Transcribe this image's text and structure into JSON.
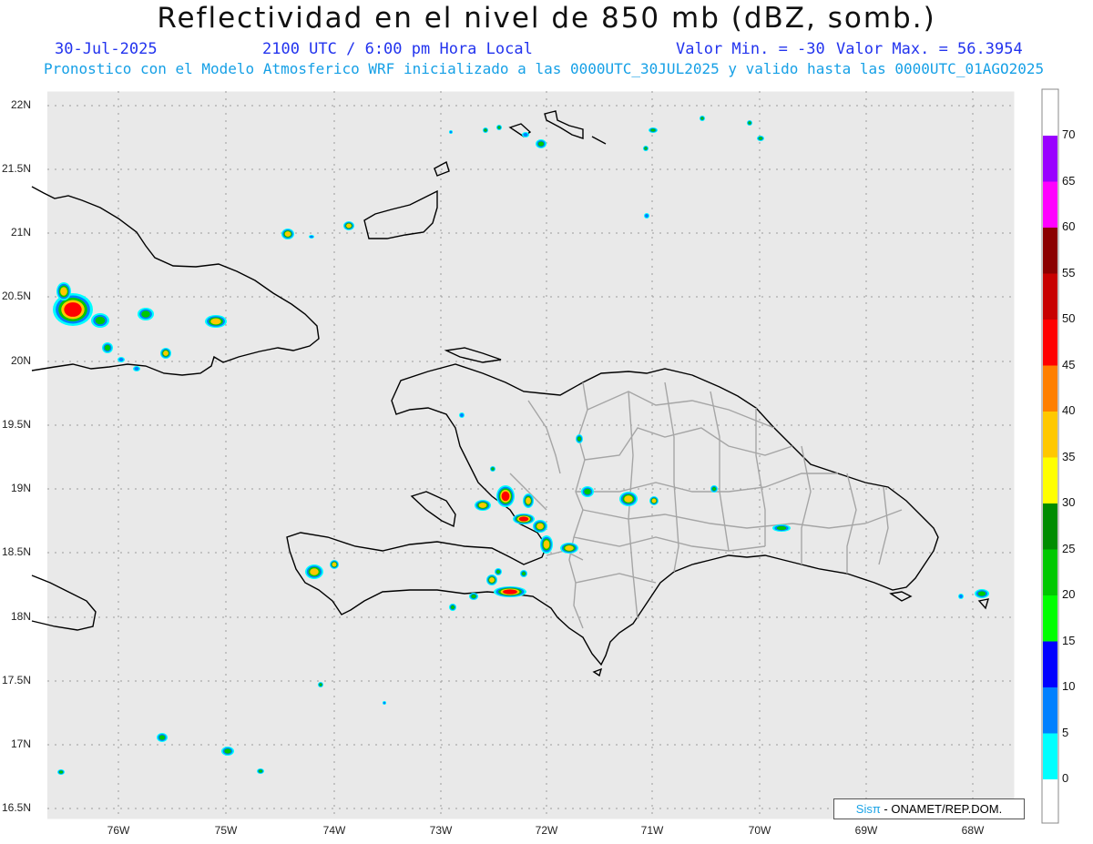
{
  "header": {
    "title": "Reflectividad en el nivel de 850 mb (dBZ, somb.)",
    "date": "30-Jul-2025",
    "time": "2100 UTC / 6:00 pm Hora Local",
    "min_label": "Valor Min. = -30",
    "max_label": "Valor Max. = 56.3954",
    "forecast_line": "Pronostico con el Modelo Atmosferico WRF inicializado a las 0000UTC_30JUL2025 y valido hasta las  0000UTC_01AGO2025"
  },
  "axes": {
    "lat_labels": [
      "22N",
      "21.5N",
      "21N",
      "20.5N",
      "20N",
      "19.5N",
      "19N",
      "18.5N",
      "18N",
      "17.5N",
      "17N",
      "16.5N"
    ],
    "lon_labels": [
      "76W",
      "75W",
      "74W",
      "73W",
      "72W",
      "71W",
      "70W",
      "69W",
      "68W"
    ]
  },
  "colorbar": {
    "ticks": [
      "70",
      "65",
      "60",
      "55",
      "50",
      "45",
      "40",
      "35",
      "30",
      "25",
      "20",
      "15",
      "10",
      "5",
      "0"
    ],
    "colors": [
      "#9a00ff",
      "#ff00ff",
      "#8b0000",
      "#c80000",
      "#ff0000",
      "#ff7f00",
      "#ffc800",
      "#ffff00",
      "#008c00",
      "#00c800",
      "#00ff00",
      "#0000ff",
      "#0080ff",
      "#00ffff"
    ]
  },
  "footer": {
    "brand": "Sisπ",
    "credit": " - ONAMET/REP.DOM."
  },
  "legend_colors": {
    "land_outline": "#000000",
    "province_lines": "#a0a0a0",
    "map_background": "#e9e9e9"
  }
}
